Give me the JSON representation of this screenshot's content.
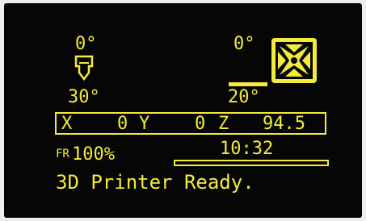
{
  "colors": {
    "text": "#f4ea3c",
    "screen": "#060606",
    "bezel": "#eeeeee"
  },
  "hotend": {
    "current": "0°",
    "target": "30°",
    "icon": "nozzle-icon"
  },
  "bed": {
    "current": "0°",
    "target": "20°",
    "icon": "bed-icon"
  },
  "fan": {
    "icon": "fan-icon"
  },
  "coords": {
    "x_label": "X",
    "x_value": "0",
    "y_label": "Y",
    "y_value": "0",
    "z_label": "Z",
    "z_value": "94.5"
  },
  "feedrate": {
    "prefix": "FR",
    "value": "100%"
  },
  "print": {
    "elapsed": "10:32",
    "progress": 0
  },
  "status": {
    "message": "3D Printer Ready."
  }
}
